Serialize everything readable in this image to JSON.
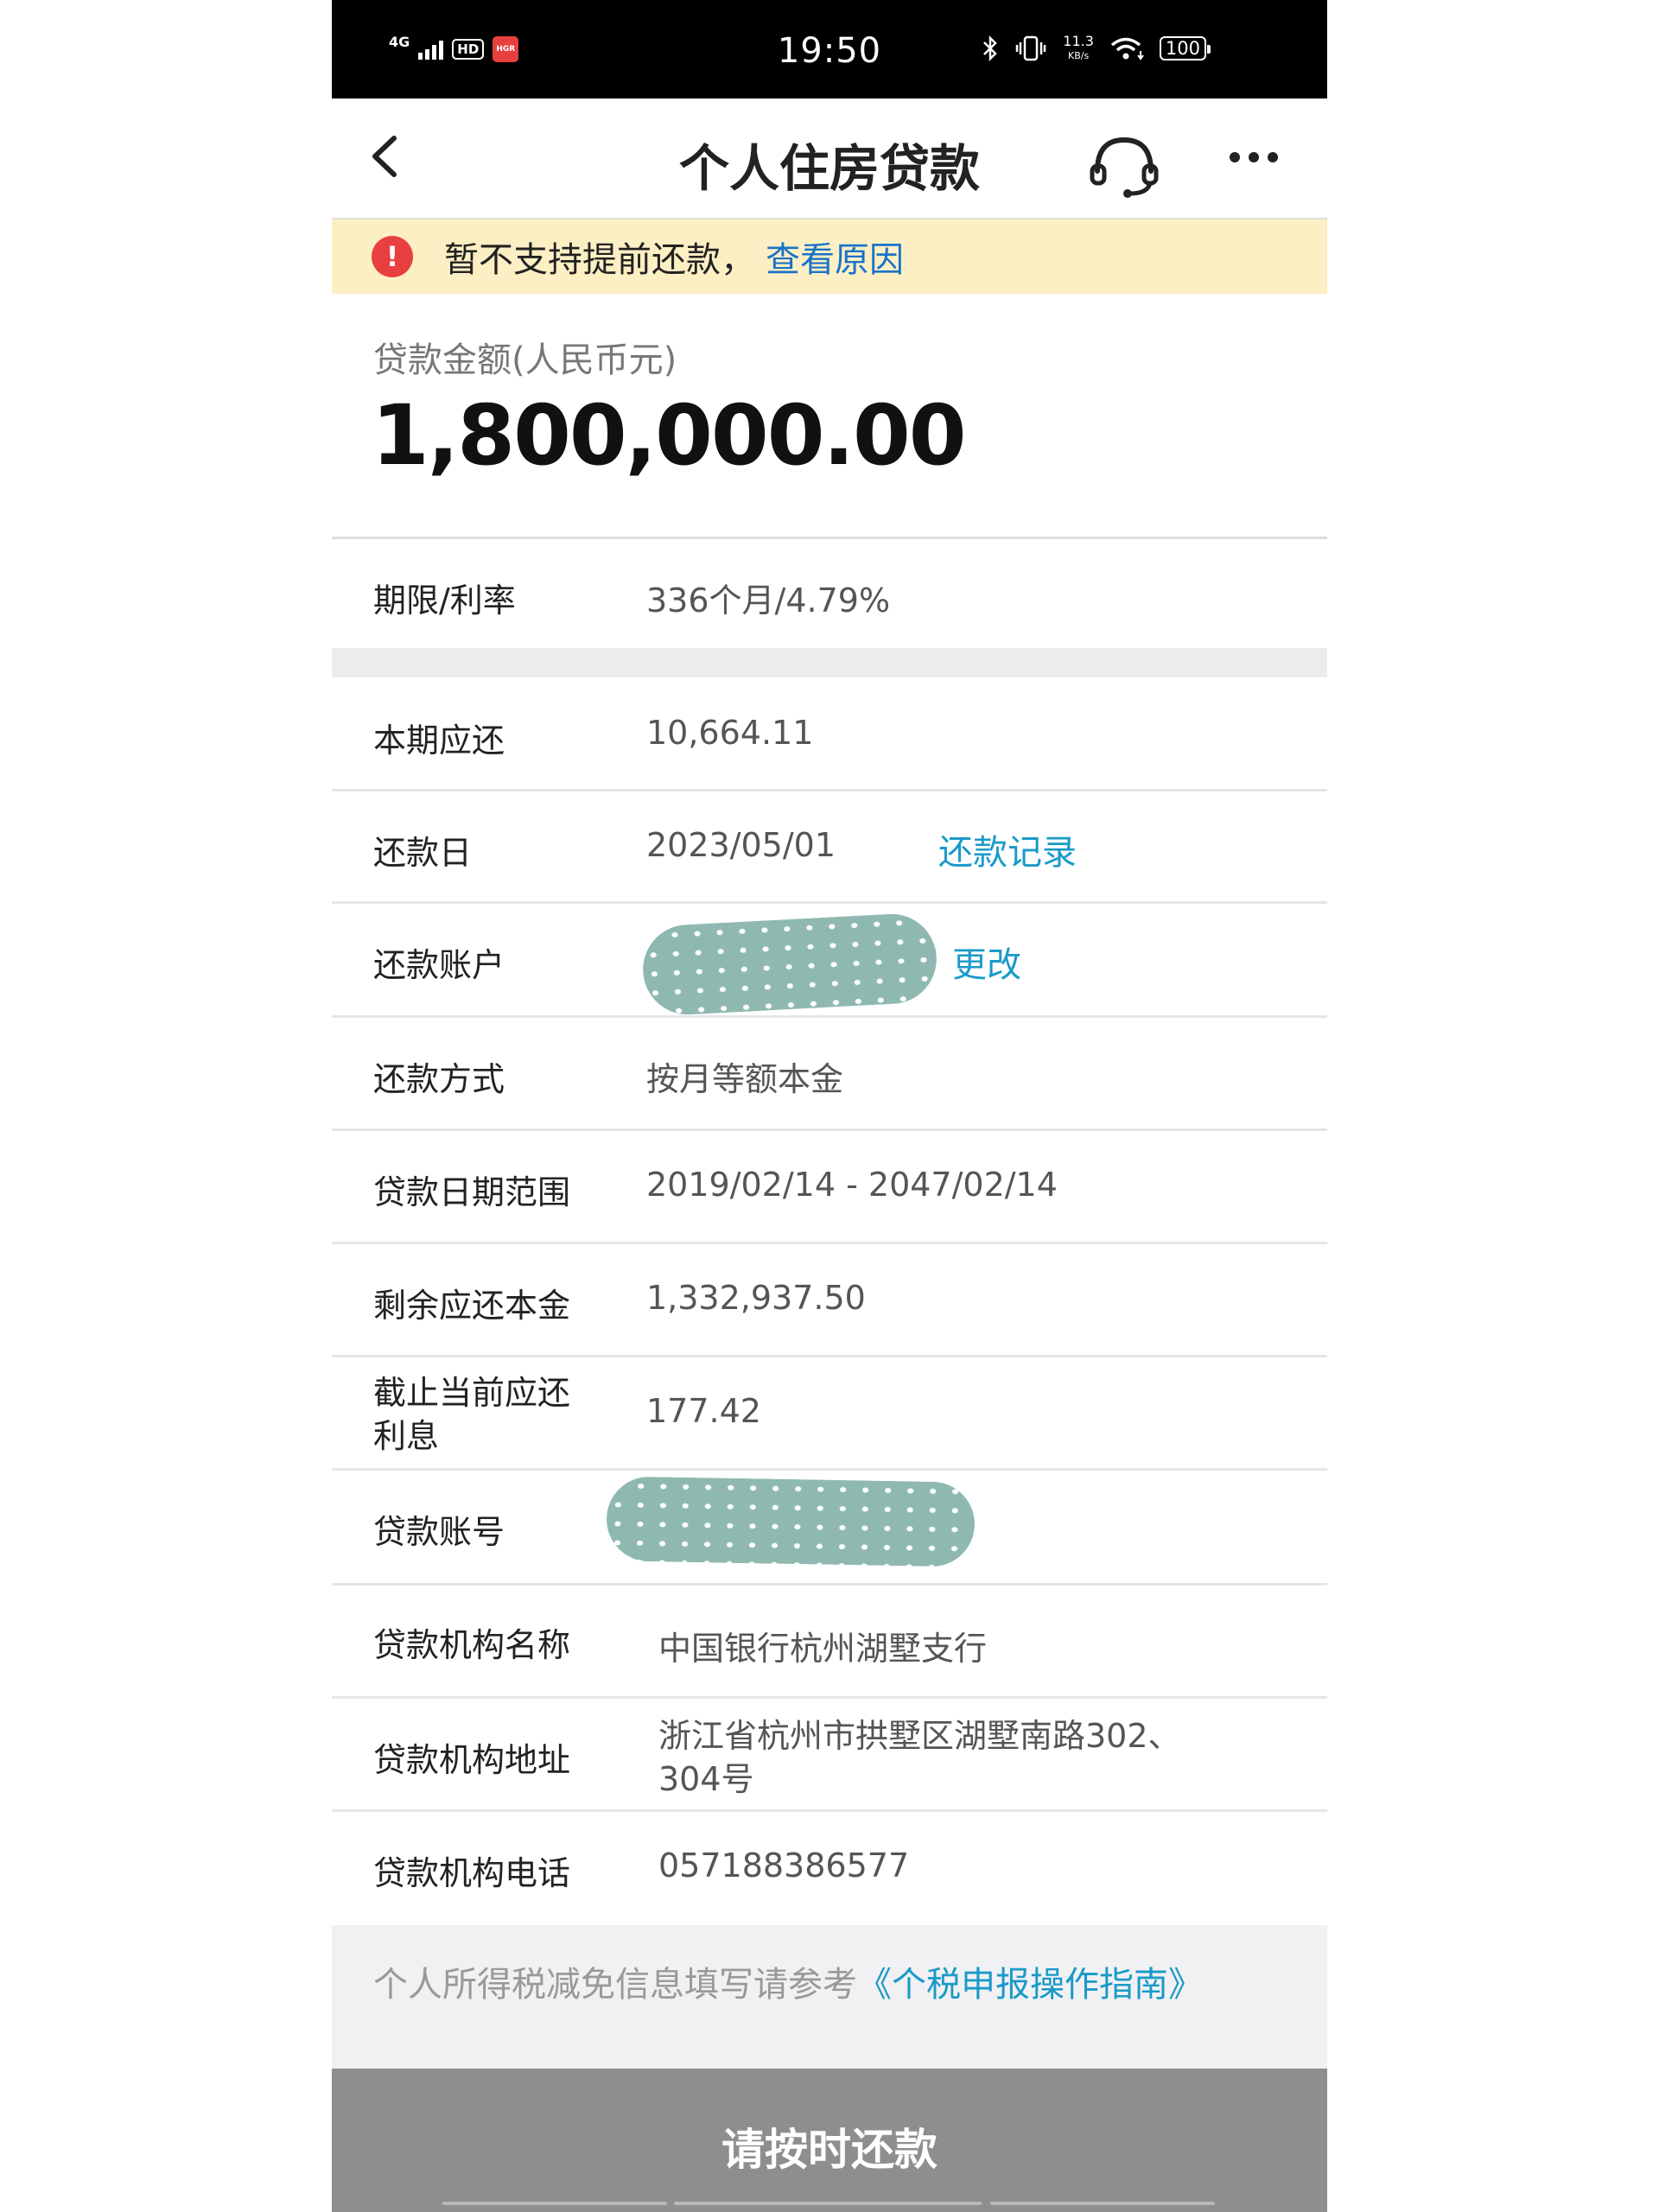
{
  "status_bar": {
    "network": "4G",
    "hd": "HD",
    "app_badge": "HGR",
    "time": "19:50",
    "speed_value": "11.3",
    "speed_unit": "KB/s",
    "battery": "100"
  },
  "nav": {
    "title": "个人住房贷款",
    "back_icon": "chevron-left-icon",
    "service_icon": "headset-icon",
    "more_icon": "more-dots-icon"
  },
  "notice": {
    "icon": "!",
    "text": "暂不支持提前还款，",
    "link": "查看原因"
  },
  "loan": {
    "amount_label": "贷款金额(人民币元)",
    "amount_value": "1,800,000.00"
  },
  "rows": {
    "term": {
      "label": "期限/利率",
      "value": "336个月/4.79%"
    },
    "due": {
      "label": "本期应还",
      "value": "10,664.11"
    },
    "repay_day": {
      "label": "还款日",
      "value": "2023/05/01",
      "link": "还款记录"
    },
    "account": {
      "label": "还款账户",
      "link": "更改"
    },
    "method": {
      "label": "还款方式",
      "value": "按月等额本金"
    },
    "date_range": {
      "label": "贷款日期范围",
      "value": "2019/02/14 - 2047/02/14"
    },
    "principal": {
      "label": "剩余应还本金",
      "value": "1,332,937.50"
    },
    "interest": {
      "label_line1": "截止当前应还",
      "label_line2": "利息",
      "value": "177.42"
    },
    "loan_account": {
      "label": "贷款账号"
    },
    "org_name": {
      "label": "贷款机构名称",
      "value": "中国银行杭州湖墅支行"
    },
    "org_address": {
      "label": "贷款机构地址",
      "value_line1": "浙江省杭州市拱墅区湖墅南路302、",
      "value_line2": "304号"
    },
    "org_phone": {
      "label": "贷款机构电话",
      "value": "057188386577"
    }
  },
  "tax": {
    "text": "个人所得税减免信息填写请参考",
    "link": "《个税申报操作指南》"
  },
  "footer": {
    "button_label": "请按时还款"
  },
  "colors": {
    "notice_bg": "#fdefc4",
    "link_blue": "#1a73c8",
    "link_cyan": "#1a9ac8",
    "button_gray": "#8e8e8e",
    "alert_red": "#e84040"
  }
}
